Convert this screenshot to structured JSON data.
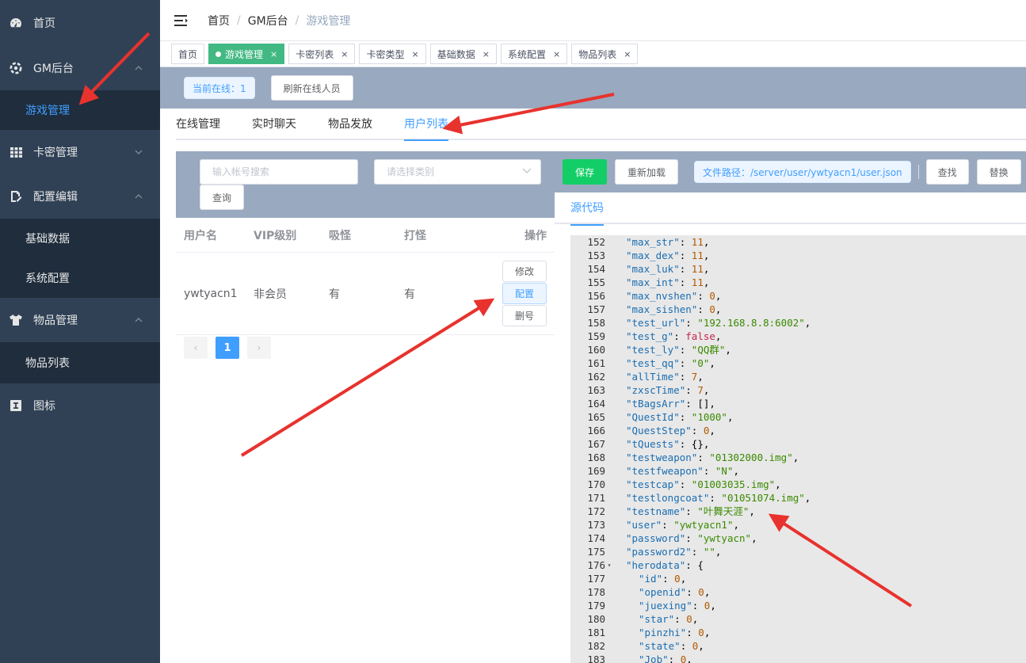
{
  "sidebar": {
    "items": [
      {
        "label": "首页",
        "icon": "dashboard-icon"
      },
      {
        "label": "GM后台",
        "icon": "gear-ring-icon",
        "expanded": true,
        "children": [
          {
            "label": "游戏管理",
            "active": true
          }
        ]
      },
      {
        "label": "卡密管理",
        "icon": "table-grid-icon",
        "expanded": false
      },
      {
        "label": "配置编辑",
        "icon": "edit-document-icon",
        "expanded": true,
        "children": [
          {
            "label": "基础数据"
          },
          {
            "label": "系统配置"
          }
        ]
      },
      {
        "label": "物品管理",
        "icon": "tshirt-icon",
        "expanded": true,
        "children": [
          {
            "label": "物品列表"
          }
        ]
      },
      {
        "label": "图标",
        "icon": "icon-library-icon"
      }
    ]
  },
  "breadcrumb": [
    "首页",
    "GM后台",
    "游戏管理"
  ],
  "tags": [
    {
      "label": "首页",
      "active": false,
      "closable": false
    },
    {
      "label": "游戏管理",
      "active": true,
      "closable": true
    },
    {
      "label": "卡密列表",
      "active": false,
      "closable": true
    },
    {
      "label": "卡密类型",
      "active": false,
      "closable": true
    },
    {
      "label": "基础数据",
      "active": false,
      "closable": true
    },
    {
      "label": "系统配置",
      "active": false,
      "closable": true
    },
    {
      "label": "物品列表",
      "active": false,
      "closable": true
    }
  ],
  "tag_close": "×",
  "online": {
    "label": "当前在线：1",
    "refresh_label": "刷新在线人员"
  },
  "tabs": [
    "在线管理",
    "实时聊天",
    "物品发放",
    "用户列表"
  ],
  "active_tab": "用户列表",
  "search": {
    "placeholder": "输入帐号搜索",
    "select_placeholder": "请选择类别",
    "query_label": "查询"
  },
  "table": {
    "headers": [
      "用户名",
      "VIP级别",
      "吸怪",
      "打怪",
      "操作"
    ],
    "rows": [
      {
        "username": "ywtyacn1",
        "vip": "非会员",
        "xiguai": "有",
        "daguai": "有"
      }
    ],
    "actions": [
      "修改",
      "配置",
      "删号"
    ]
  },
  "pager": {
    "prev": "‹",
    "current": "1",
    "next": "›"
  },
  "toolbar": {
    "save_label": "保存",
    "reload_label": "重新加载",
    "path_label": "文件路径：/server/user/ywtyacn1/user.json",
    "find_label": "查找",
    "replace_label": "替换"
  },
  "source_tab": "源代码",
  "code_lines": [
    {
      "n": "152",
      "key": "max_str",
      "val": "11",
      "t": "num",
      "indent": 1
    },
    {
      "n": "153",
      "key": "max_dex",
      "val": "11",
      "t": "num",
      "indent": 1
    },
    {
      "n": "154",
      "key": "max_luk",
      "val": "11",
      "t": "num",
      "indent": 1
    },
    {
      "n": "155",
      "key": "max_int",
      "val": "11",
      "t": "num",
      "indent": 1
    },
    {
      "n": "156",
      "key": "max_nvshen",
      "val": "0",
      "t": "num",
      "indent": 1
    },
    {
      "n": "157",
      "key": "max_sishen",
      "val": "0",
      "t": "num",
      "indent": 1
    },
    {
      "n": "158",
      "key": "test_url",
      "val": "\"192.168.8.8:6002\"",
      "t": "str",
      "indent": 1
    },
    {
      "n": "159",
      "key": "test_g",
      "val": "false",
      "t": "bool",
      "indent": 1
    },
    {
      "n": "160",
      "key": "test_ly",
      "val": "\"QQ群\"",
      "t": "str",
      "indent": 1
    },
    {
      "n": "161",
      "key": "test_qq",
      "val": "\"0\"",
      "t": "str",
      "indent": 1
    },
    {
      "n": "162",
      "key": "allTime",
      "val": "7",
      "t": "num",
      "indent": 1
    },
    {
      "n": "163",
      "key": "zxscTime",
      "val": "7",
      "t": "num",
      "indent": 1
    },
    {
      "n": "164",
      "key": "tBagsArr",
      "val": "[]",
      "t": "plain",
      "indent": 1
    },
    {
      "n": "165",
      "key": "QuestId",
      "val": "\"1000\"",
      "t": "str",
      "indent": 1
    },
    {
      "n": "166",
      "key": "QuestStep",
      "val": "0",
      "t": "num",
      "indent": 1
    },
    {
      "n": "167",
      "key": "tQuests",
      "val": "{}",
      "t": "plain",
      "indent": 1
    },
    {
      "n": "168",
      "key": "testweapon",
      "val": "\"01302000.img\"",
      "t": "str",
      "indent": 1
    },
    {
      "n": "169",
      "key": "testfweapon",
      "val": "\"N\"",
      "t": "str",
      "indent": 1
    },
    {
      "n": "170",
      "key": "testcap",
      "val": "\"01003035.img\"",
      "t": "str",
      "indent": 1
    },
    {
      "n": "171",
      "key": "testlongcoat",
      "val": "\"01051074.img\"",
      "t": "str",
      "indent": 1
    },
    {
      "n": "172",
      "key": "testname",
      "val": "\"叶舞天涯\"",
      "t": "str",
      "indent": 1
    },
    {
      "n": "173",
      "key": "user",
      "val": "\"ywtyacn1\"",
      "t": "str",
      "indent": 1
    },
    {
      "n": "174",
      "key": "password",
      "val": "\"ywtyacn\"",
      "t": "str",
      "indent": 1
    },
    {
      "n": "175",
      "key": "password2",
      "val": "\"\"",
      "t": "str",
      "indent": 1
    },
    {
      "n": "176",
      "key": "herodata",
      "val": "{",
      "t": "open",
      "indent": 1,
      "fold": true
    },
    {
      "n": "177",
      "key": "id",
      "val": "0",
      "t": "num",
      "indent": 2
    },
    {
      "n": "178",
      "key": "openid",
      "val": "0",
      "t": "num",
      "indent": 2
    },
    {
      "n": "179",
      "key": "juexing",
      "val": "0",
      "t": "num",
      "indent": 2
    },
    {
      "n": "180",
      "key": "star",
      "val": "0",
      "t": "num",
      "indent": 2
    },
    {
      "n": "181",
      "key": "pinzhi",
      "val": "0",
      "t": "num",
      "indent": 2
    },
    {
      "n": "182",
      "key": "state",
      "val": "0",
      "t": "num",
      "indent": 2
    },
    {
      "n": "183",
      "key": "Job",
      "val": "0",
      "t": "num",
      "indent": 2
    }
  ],
  "colors": {
    "sidebar_bg": "#304156",
    "submenu_bg": "#1f2d3d",
    "accent": "#409eff",
    "tag_active": "#42b983",
    "save_green": "#13ce66",
    "panel_gray": "#99a9bf",
    "arrow_red": "#e8322d"
  }
}
